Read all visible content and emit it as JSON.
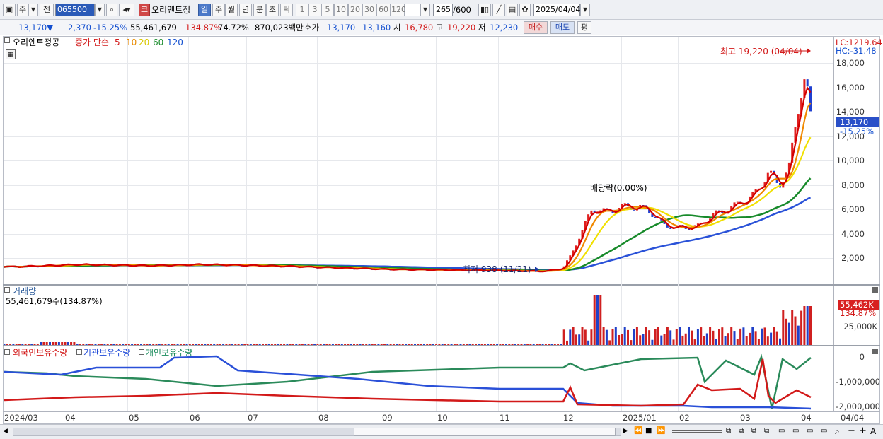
{
  "toolbar": {
    "period_label": "주",
    "prev_label": "전",
    "code": "065500",
    "market_tag": "코",
    "name": "오리엔트정",
    "periods": [
      "일",
      "주",
      "월",
      "년",
      "분",
      "초",
      "틱"
    ],
    "active_period": "일",
    "intervals": [
      "1",
      "3",
      "5",
      "10",
      "20",
      "30",
      "60",
      "120"
    ],
    "count": "265",
    "count_max": "/600",
    "date": "2025/04/04"
  },
  "quote": {
    "price": "13,170▼",
    "change": "2,370",
    "change_pct": "-15.25%",
    "volume": "55,461,679",
    "vol_ratio": "134.87%",
    "turnover_pct": "74.72%",
    "amount": "870,023백만",
    "hoga_label": "호가",
    "ask": "13,170",
    "bid": "13,160",
    "open_label": "시",
    "open": "16,780",
    "high_label": "고",
    "high": "19,220",
    "low_label": "저",
    "low": "12,230",
    "buy_label": "매수",
    "sell_label": "매도",
    "eval_label": "평"
  },
  "price_panel": {
    "legend_name": "오리엔트정공",
    "legend_ma_prefix": "종가 단순",
    "ma_periods": [
      "5",
      "10",
      "20",
      "60",
      "120"
    ],
    "ma_colors": [
      "#d40000",
      "#e88a00",
      "#e8d400",
      "#178a2a",
      "#2a52d8"
    ],
    "lc_label": "LC:1219.64",
    "hc_label": "HC:-31.48",
    "high_note": "최고 19,220 (04/04)",
    "low_note": "최저 938 (11/21)",
    "dividend_note": "배당락(0.00%)",
    "current_price": "13,170",
    "current_pct": "-15.25%",
    "y_ticks": [
      "18,000",
      "16,000",
      "14,000",
      "12,000",
      "10,000",
      "8,000",
      "6,000",
      "4,000",
      "2,000"
    ]
  },
  "volume_panel": {
    "title": "거래량",
    "value_text": "55,461,679주(134.87%)",
    "badge_value": "55,462K",
    "badge_pct": "134.87%",
    "y_tick": "25,000K"
  },
  "holding_panel": {
    "legend": [
      {
        "label": "외국인보유수량",
        "color": "#d21919"
      },
      {
        "label": "기관보유수량",
        "color": "#1c48d8"
      },
      {
        "label": "개인보유수량",
        "color": "#178a5a"
      }
    ],
    "y_ticks": [
      "0",
      "-1,000,000",
      "-2,000,000"
    ]
  },
  "x_axis": [
    "2024/03",
    "04",
    "05",
    "06",
    "07",
    "08",
    "09",
    "10",
    "11",
    "12",
    "2025/01",
    "02",
    "03",
    "04",
    "04/04"
  ]
}
